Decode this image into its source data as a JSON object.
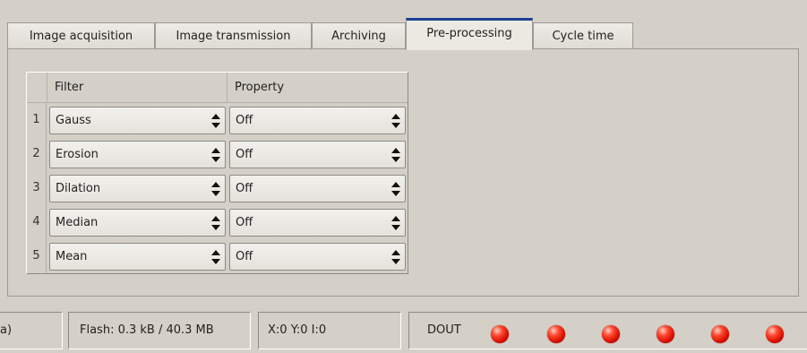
{
  "tabs": [
    {
      "label": "Image acquisition",
      "active": false
    },
    {
      "label": "Image transmission",
      "active": false
    },
    {
      "label": "Archiving",
      "active": false
    },
    {
      "label": "Pre-processing",
      "active": true
    },
    {
      "label": "Cycle time",
      "active": false
    }
  ],
  "table": {
    "columns": [
      "Filter",
      "Property"
    ],
    "rows": [
      {
        "index": "1",
        "filter": "Gauss",
        "property": "Off"
      },
      {
        "index": "2",
        "filter": "Erosion",
        "property": "Off"
      },
      {
        "index": "3",
        "filter": "Dilation",
        "property": "Off"
      },
      {
        "index": "4",
        "filter": "Median",
        "property": "Off"
      },
      {
        "index": "5",
        "filter": "Mean",
        "property": "Off"
      }
    ]
  },
  "status": {
    "left_fragment": "a)",
    "flash": "Flash:  0.3 kB / 40.3 MB",
    "coords": "X:0 Y:0 I:0",
    "dout_label": "DOUT",
    "dout_leds": [
      "on",
      "on",
      "on",
      "on",
      "on",
      "on"
    ]
  },
  "colors": {
    "led_on": "#e01a00",
    "active_tab_accent": "#1c3f96",
    "background": "#d4d0c8"
  }
}
